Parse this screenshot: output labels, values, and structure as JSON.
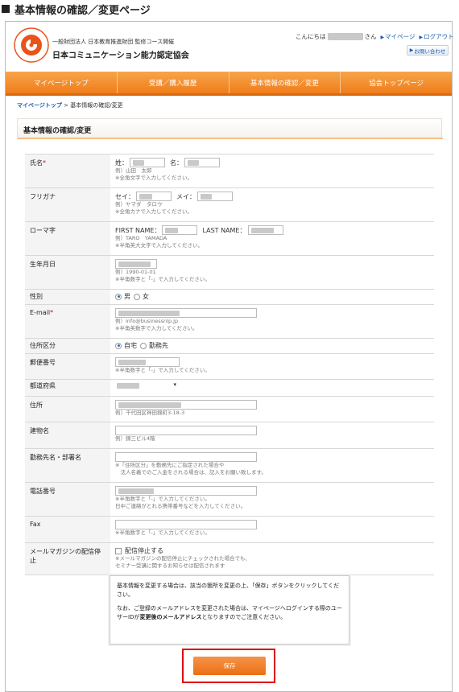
{
  "page_heading": "基本情報の確認／変更ページ",
  "header": {
    "org_sub": "一般財団法人 日本教育推進財団 監修コース開催",
    "org_name": "日本コミュニケーション能力認定協会",
    "greeting_prefix": "こんにちは",
    "greeting_suffix": "さん",
    "mypage_link": "マイページ",
    "logout_link": "ログアウト",
    "contact_button": "お問い合わせ"
  },
  "nav": {
    "items": [
      "マイページトップ",
      "受講／購入履歴",
      "基本情報の確認／変更",
      "協会トップページ"
    ]
  },
  "breadcrumb": {
    "home": "マイページトップ",
    "separator": ">",
    "current": "基本情報の確認/変更"
  },
  "section_title": "基本情報の確認/変更",
  "form": {
    "name": {
      "label": "氏名",
      "required_mark": "*",
      "sei_label": "姓：",
      "mei_label": "名：",
      "example": "例）山田　太郎",
      "note": "※全角文字で入力してください。"
    },
    "kana": {
      "label": "フリガナ",
      "sei_label": "セイ：",
      "mei_label": "メイ：",
      "example": "例）ヤマダ　タロウ",
      "note": "※全角カナで入力してください。"
    },
    "romaji": {
      "label": "ローマ字",
      "first_label": "FIRST NAME：",
      "last_label": "LAST NAME：",
      "example": "例）TARO　YAMADA",
      "note": "※半角英大文字で入力してください。"
    },
    "birthdate": {
      "label": "生年月日",
      "example": "例）1990-01-01",
      "note": "※半角数字と「-」で入力してください。"
    },
    "gender": {
      "label": "性別",
      "options": [
        "男",
        "女"
      ],
      "selected": "男"
    },
    "email": {
      "label": "E-mail",
      "required_mark": "*",
      "example": "例）info@businessnlp.jp",
      "note": "※半角英数字で入力してください。"
    },
    "address_type": {
      "label": "住所区分",
      "options": [
        "自宅",
        "勤務先"
      ],
      "selected": "自宅"
    },
    "postal": {
      "label": "郵便番号",
      "note": "※半角数字と「-」で入力してください。"
    },
    "prefecture": {
      "label": "都道府県"
    },
    "address": {
      "label": "住所",
      "example": "例）千代田区神田錦町3-18-3"
    },
    "building": {
      "label": "建物名",
      "example": "例）錦三ビル4階"
    },
    "company": {
      "label": "勤務先名・部署名",
      "note1": "※「住所区分」を勤務先にご指定された場合や",
      "note2": "　法人名義でのご入金をされる場合は、記入をお願い致します。"
    },
    "phone": {
      "label": "電話番号",
      "note1": "※半角数字と「-」で入力してください。",
      "note2": "日中ご連絡がとれる携帯番号などを入力してください。"
    },
    "fax": {
      "label": "Fax",
      "note": "※半角数字と「-」で入力してください。"
    },
    "newsletter": {
      "label": "メールマガジンの配信停止",
      "checkbox_label": "配信停止する",
      "note1": "※メールマガジンの配信停止にチェックされた場合でも、",
      "note2": "セミナー受講に関するお知らせは配信されます"
    }
  },
  "notice": {
    "paragraph1": "基本情報を変更する場合は、該当の箇所を変更の上、「保存」ボタンをクリックしてください。",
    "paragraph2_before": "なお、ご登録のメールアドレスを変更された場合は、マイページへログインする際のユーザーIDが",
    "paragraph2_bold": "変更後のメールアドレス",
    "paragraph2_after": "となりますのでご注意ください。"
  },
  "save_button": "保存",
  "colors": {
    "accent": "#ef7d1a",
    "link": "#1a5ba8",
    "required": "#dd0000",
    "highlight_border": "#e00000"
  }
}
